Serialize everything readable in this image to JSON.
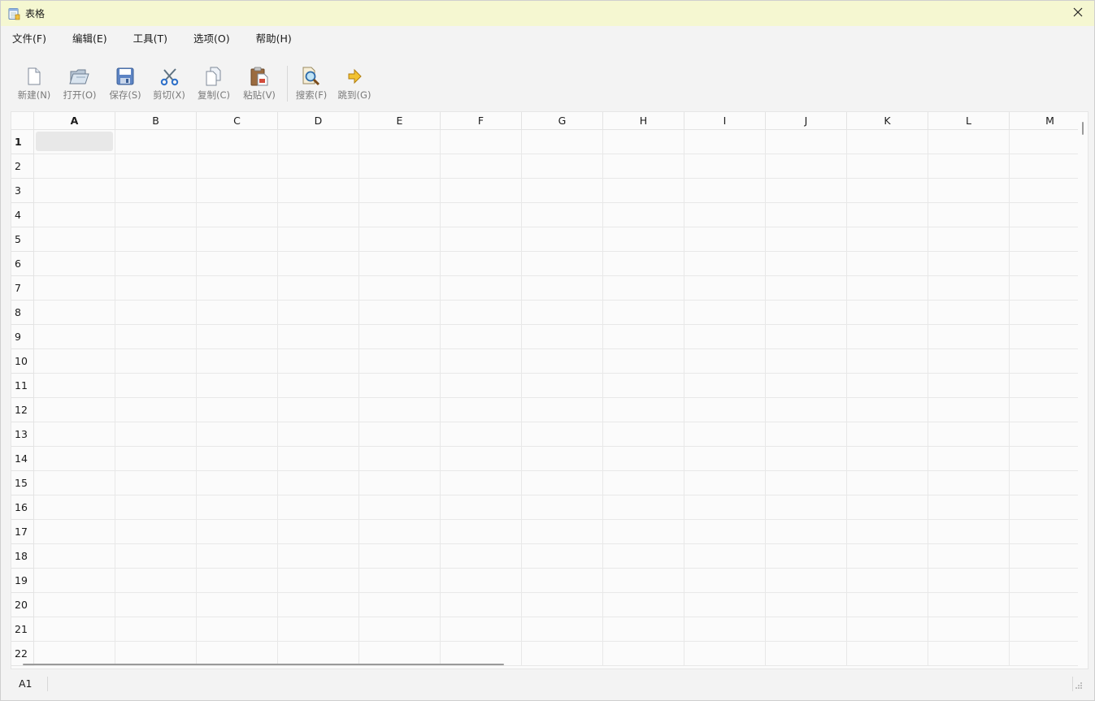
{
  "window": {
    "title": "表格",
    "icon": "sheet-app-icon",
    "close_icon": "close-icon"
  },
  "menu": [
    {
      "label": "文件(F)"
    },
    {
      "label": "编辑(E)"
    },
    {
      "label": "工具(T)"
    },
    {
      "label": "选项(O)"
    },
    {
      "label": "帮助(H)"
    }
  ],
  "toolbar": [
    {
      "label": "新建(N)",
      "icon": "new-file-icon"
    },
    {
      "label": "打开(O)",
      "icon": "open-folder-icon"
    },
    {
      "label": "保存(S)",
      "icon": "save-disk-icon"
    },
    {
      "label": "剪切(X)",
      "icon": "scissors-icon"
    },
    {
      "label": "复制(C)",
      "icon": "copy-icon"
    },
    {
      "label": "粘贴(V)",
      "icon": "paste-clipboard-icon"
    },
    {
      "label": "搜索(F)",
      "icon": "search-magnifier-icon"
    },
    {
      "label": "跳到(G)",
      "icon": "goto-arrow-icon"
    }
  ],
  "grid": {
    "columns": [
      "A",
      "B",
      "C",
      "D",
      "E",
      "F",
      "G",
      "H",
      "I",
      "J",
      "K",
      "L",
      "M"
    ],
    "rows": [
      "1",
      "2",
      "3",
      "4",
      "5",
      "6",
      "7",
      "8",
      "9",
      "10",
      "11",
      "12",
      "13",
      "14",
      "15",
      "16",
      "17",
      "18",
      "19",
      "20",
      "21",
      "22"
    ],
    "active_column": "A",
    "active_row": "1"
  },
  "status": {
    "cell_ref": "A1"
  },
  "colors": {
    "titlebar": "#f5f7d1",
    "background": "#f3f3f3",
    "grid_bg": "#fbfbfb"
  }
}
